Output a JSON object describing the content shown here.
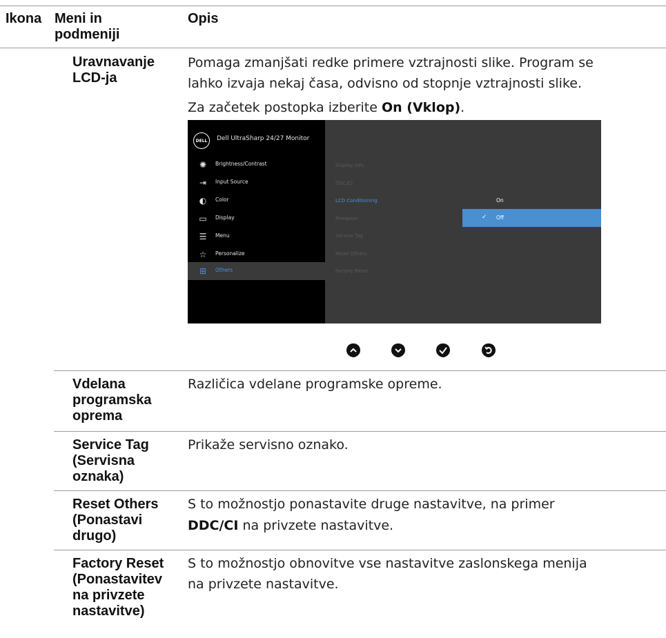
{
  "header": {
    "col_icon": "Ikona",
    "col_menu_line1": "Meni in",
    "col_menu_line2": "podmeniji",
    "col_desc": "Opis"
  },
  "rows": [
    {
      "menu_lines": [
        "Uravnavanje",
        "LCD-ja"
      ],
      "desc_lines": [
        "Pomaga zmanjšati redke primere vztrajnosti slike. Program se",
        "lahko izvaja nekaj časa, odvisno od stopnje vztrajnosti slike."
      ],
      "desc_extra_prefix": "Za začetek postopka izberite ",
      "desc_extra_bold": "On (Vklop)",
      "desc_extra_suffix": "."
    },
    {
      "menu_lines": [
        "Vdelana",
        "programska",
        "oprema"
      ],
      "desc_lines": [
        "Različica vdelane programske opreme."
      ]
    },
    {
      "menu_lines": [
        "Service Tag",
        "(Servisna",
        "oznaka)"
      ],
      "desc_lines": [
        "Prikaže servisno oznako."
      ]
    },
    {
      "menu_lines": [
        "Reset Others",
        "(Ponastavi",
        "drugo)"
      ],
      "desc_line1": "S to možnostjo ponastavite druge nastavitve, na primer",
      "desc_bold": "DDC/CI",
      "desc_line2_suffix": " na privzete nastavitve."
    },
    {
      "menu_lines": [
        "Factory Reset",
        "(Ponastavitev",
        "na privzete",
        "nastavitve)"
      ],
      "desc_lines": [
        "S to možnostjo obnovitve vse nastavitve zaslonskega menija",
        "na privzete nastavitve."
      ]
    }
  ],
  "osd": {
    "logo": "DELL",
    "title": "Dell UltraSharp 24/27 Monitor",
    "menu": [
      {
        "label": "Brightness/Contrast",
        "icon": "sun-icon"
      },
      {
        "label": "Input Source",
        "icon": "input-icon"
      },
      {
        "label": "Color",
        "icon": "palette-icon"
      },
      {
        "label": "Display",
        "icon": "monitor-icon"
      },
      {
        "label": "Menu",
        "icon": "menu-icon"
      },
      {
        "label": "Personalize",
        "icon": "star-icon"
      },
      {
        "label": "Others",
        "icon": "others-icon"
      }
    ],
    "selected_menu": "Others",
    "submenu": [
      "Display Info",
      "DDC/CI",
      "LCD Conditioning",
      "Firmware",
      "Service Tag",
      "Reset Others",
      "Factory Reset"
    ],
    "active_submenu": "LCD Conditioning",
    "options": [
      "On",
      "Off"
    ],
    "selected_option": "Off",
    "accent_color": "#4a90d9"
  },
  "nav_buttons": [
    "up-icon",
    "down-icon",
    "check-icon",
    "back-icon"
  ]
}
